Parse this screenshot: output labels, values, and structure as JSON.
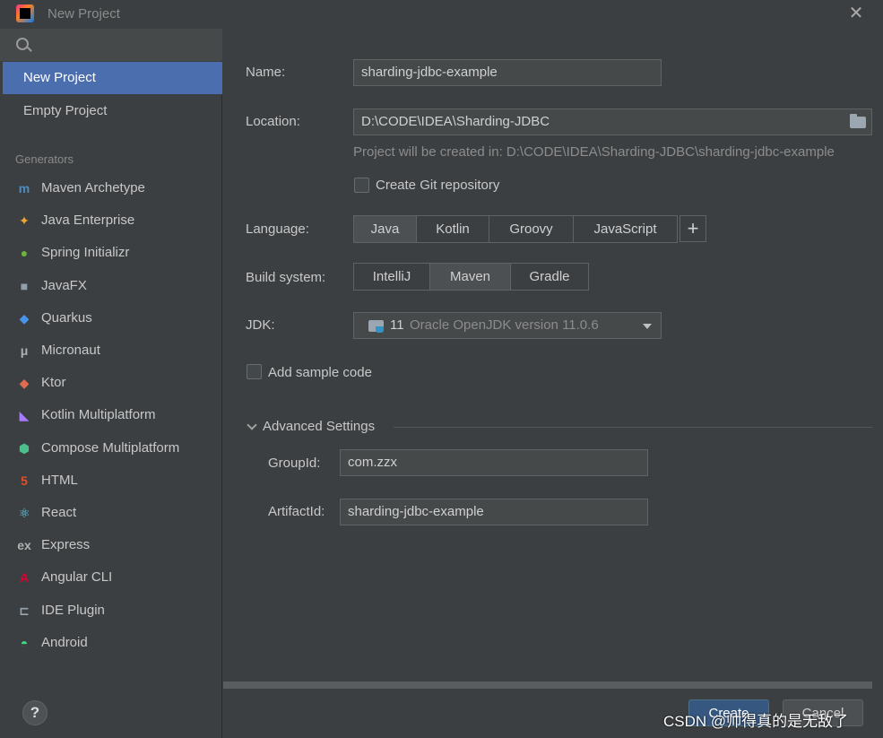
{
  "window": {
    "title": "New Project"
  },
  "sidebar": {
    "search_placeholder": "",
    "project_types": [
      {
        "label": "New Project",
        "selected": true
      },
      {
        "label": "Empty Project",
        "selected": false
      }
    ],
    "generators_label": "Generators",
    "generators": [
      {
        "label": "Maven Archetype",
        "icon": "maven-icon",
        "glyph": "m",
        "color": "#4e8cc2"
      },
      {
        "label": "Java Enterprise",
        "icon": "java-enterprise-icon",
        "glyph": "✦",
        "color": "#f0a732"
      },
      {
        "label": "Spring Initializr",
        "icon": "spring-icon",
        "glyph": "●",
        "color": "#6db33f"
      },
      {
        "label": "JavaFX",
        "icon": "javafx-icon",
        "glyph": "■",
        "color": "#8ea0b0"
      },
      {
        "label": "Quarkus",
        "icon": "quarkus-icon",
        "glyph": "◆",
        "color": "#4695eb"
      },
      {
        "label": "Micronaut",
        "icon": "micronaut-icon",
        "glyph": "μ",
        "color": "#b0b0b0"
      },
      {
        "label": "Ktor",
        "icon": "ktor-icon",
        "glyph": "◆",
        "color": "#e06c4d"
      },
      {
        "label": "Kotlin Multiplatform",
        "icon": "kotlin-icon",
        "glyph": "◣",
        "color": "#a97bff"
      },
      {
        "label": "Compose Multiplatform",
        "icon": "compose-icon",
        "glyph": "⬢",
        "color": "#4cbf8b"
      },
      {
        "label": "HTML",
        "icon": "html5-icon",
        "glyph": "5",
        "color": "#e44d26"
      },
      {
        "label": "React",
        "icon": "react-icon",
        "glyph": "⚛",
        "color": "#61dafb"
      },
      {
        "label": "Express",
        "icon": "express-icon",
        "glyph": "ex",
        "color": "#b0b0b0"
      },
      {
        "label": "Angular CLI",
        "icon": "angular-icon",
        "glyph": "A",
        "color": "#dd0031"
      },
      {
        "label": "IDE Plugin",
        "icon": "plugin-icon",
        "glyph": "⊏",
        "color": "#9aa7b0"
      },
      {
        "label": "Android",
        "icon": "android-icon",
        "glyph": "◓",
        "color": "#3ddc84"
      }
    ],
    "help_label": "?"
  },
  "form": {
    "name_label": "Name:",
    "name_value": "sharding-jdbc-example",
    "location_label": "Location:",
    "location_value": "D:\\CODE\\IDEA\\Sharding-JDBC",
    "location_hint": "Project will be created in: D:\\CODE\\IDEA\\Sharding-JDBC\\sharding-jdbc-example",
    "git_label": "Create Git repository",
    "git_checked": false,
    "language_label": "Language:",
    "languages": [
      "Java",
      "Kotlin",
      "Groovy",
      "JavaScript"
    ],
    "language_selected": "Java",
    "add_language": "+",
    "build_label": "Build system:",
    "build_systems": [
      "IntelliJ",
      "Maven",
      "Gradle"
    ],
    "build_selected": "Maven",
    "jdk_label": "JDK:",
    "jdk_version": "11",
    "jdk_name": "Oracle OpenJDK version 11.0.6",
    "sample_label": "Add sample code",
    "sample_checked": false,
    "advanced_label": "Advanced Settings",
    "group_label": "GroupId:",
    "group_value": "com.zzx",
    "artifact_label": "ArtifactId:",
    "artifact_value": "sharding-jdbc-example"
  },
  "buttons": {
    "create": "Create",
    "cancel": "Cancel"
  },
  "watermark": "CSDN @帅得真的是无敌了",
  "colors": {
    "background": "#3c3f41",
    "selection": "#4b6eaf",
    "primary_button": "#365880"
  }
}
